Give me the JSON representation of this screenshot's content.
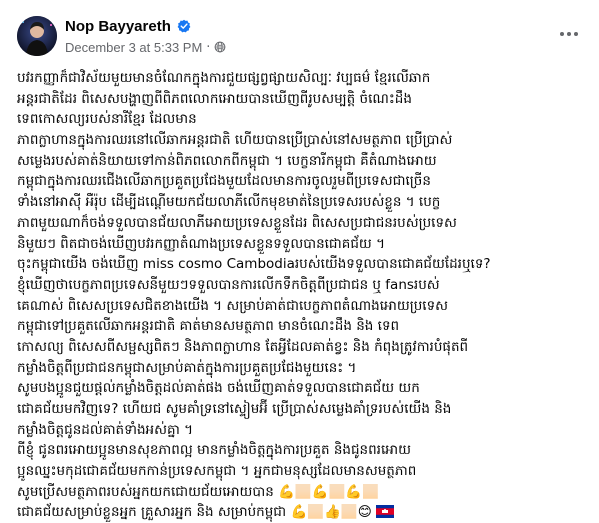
{
  "post": {
    "author": "Nop Bayyareth",
    "timestamp": "December 3 at 5:33 PM",
    "separator": "·",
    "verified_icon": "verified-badge-icon",
    "privacy_icon": "globe-icon",
    "more_icon": "more-options-icon",
    "accent_color": "#1877f2",
    "lines": [
      "បវរកញ្ញាក៏ជាវិស័យមួយមានចំណែកក្នុងការជួយផ្សព្វផ្សាយសិល្បៈ វប្បធម៌ ខ្មែរលើឆាក",
      "អន្តរជាតិដែរ ពិសេសបង្ហាញពីពិភពលោកអោយបានឃើញពីរូបសម្បត្តិ ចំណេះដឹង",
      "ទេពកោសល្យរបស់នារីខ្មែរ ដែលមាន",
      "ភាពក្លាហានក្នុងការឈរនៅលើឆាកអន្តរជាតិ ហើយបានប្រើប្រាស់នៅសមត្ថភាព ប្រើប្រាស់",
      "សម្លេងរបស់គាត់និយាយទៅកាន់ពិភពលោកពីកម្ពុជា ។ បេក្ខនារីកម្ពុជា គឺតំណាងអោយ",
      "កម្ពុជាក្នុងការឈរជើងលើឆាកប្រគួតប្រជែងមួយដែលមានការចូលរួមពីប្រទេសជាច្រើន",
      "ទាំងនៅអាស៊ី អឺរ៉ុប ដើម្បីដណ្តើមយកជ័យលាភីលើកមុខមាត់នៃប្រទេសរបស់ខ្លួន ។ បេក្ខ",
      "ភាពមួយណាក៏ចង់ទទួលបានជ័យលាភីអោយប្រទេសខ្លួនដែរ ពិសេសប្រជាជនរបស់ប្រទេស",
      "និមួយៗ ពិតជាចង់ឃើញបវរកញ្ញាតំណាងប្រទេសខ្លួនទទួលបានជោគជ័យ ។",
      "ចុះកម្ពុជាយើង ចង់ឃើញ miss cosmo Cambodiaរបស់យើងទទួលបានជោគជ័យដែរឬទេ?",
      "ខ្ញុំឃើញថាបេក្ខភាពប្រទេសនីមួយៗទទួលបានការលើកទឹកចិត្តពីប្រជាជន ឬ fansរបស់",
      "គេណាស់ ពិសេសប្រទេសជិតខាងយើង ។ សម្រាប់គាត់ជាបេក្ខភាពតំណាងអោយប្រទេស",
      "កម្ពុជាទៅប្រគួតលើឆាកអន្តរជាតិ គាត់មានសមត្ថភាព មានចំណេះដឹង និង ទេព",
      "កោសល្យ ពិសេសពីសម្ផស្សពិតៗ និងភាពក្លាហាន តែអ្វីដែលគាត់ខ្វះ និង កំពុងត្រូវការបំផុតពី",
      "កម្លាំងចិត្តពីប្រជាជនកម្ពុជាសម្រាប់គាត់ក្នុងការប្រគួតប្រជែងមួយនេះ ។",
      "សូមបងប្អូនជួយផ្តល់កម្លាំងចិត្តដល់គាត់ផង ចង់ឃើញគាត់ទទួលបានជោគជ័យ យក",
      "ជោគជ័យមកវិញទេ? ហើយជ សូមគាំទ្រនៅស្ទៀមអ៊ី ប្រើប្រាស់សម្លេងគាំទ្ររបស់យើង និង",
      "កម្លាំងចិត្តជូនដល់គាត់ទាំងអស់គ្នា ។",
      "ពីខ្ញុំ ជូនពរអោយប្អូនមានសុខភាពល្អ មានកម្លាំងចិត្តក្នុងការប្រគួត និងជូនពរអោយ",
      "ប្អូនឈ្នះមកុដជោគជ័យមកកាន់ប្រទេសកម្ពុជា ។ អ្នកជាមនុស្សដែលមានសមត្ថភាព",
      "សូមប្រើសមត្ថភាពរបស់អ្នកយកជោយជ័យអោយបាន 💪🏻💪🏻💪🏻",
      "ជោគជ័យសម្រាប់ខ្លួនអ្នក គ្រួសារអ្នក និង សម្រាប់កម្ពុជា 💪🏻👍🏻😊"
    ],
    "flag_label": "Cambodia flag"
  }
}
